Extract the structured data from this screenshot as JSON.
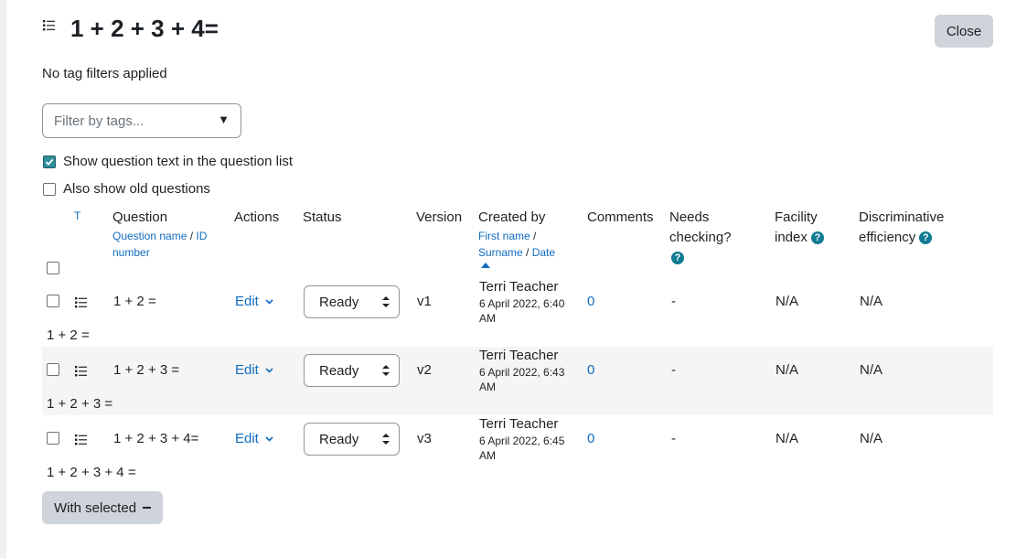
{
  "header": {
    "title": "1 + 2 + 3 + 4=",
    "close_label": "Close"
  },
  "tags": {
    "status": "No tag filters applied",
    "filter_placeholder": "Filter by tags...",
    "filter_arrow": "▼"
  },
  "options": {
    "show_question_text": {
      "label": "Show question text in the question list",
      "checked": true
    },
    "show_old_questions": {
      "label": "Also show old questions",
      "checked": false
    }
  },
  "table": {
    "headers": {
      "type": "T",
      "question": "Question",
      "question_sub_name": "Question name",
      "question_sub_sep": " / ",
      "question_sub_id": "ID number",
      "actions": "Actions",
      "status": "Status",
      "version": "Version",
      "created_by": "Created by",
      "created_first": "First name",
      "created_sep1": " / ",
      "created_surname": "Surname",
      "created_sep2": " / ",
      "created_date": "Date",
      "comments": "Comments",
      "needs_checking": "Needs checking?",
      "facility_index": "Facility index",
      "discriminative": "Discriminative efficiency"
    },
    "rows": [
      {
        "name": "1 + 2 =",
        "action": "Edit",
        "status": "Ready",
        "version": "v1",
        "creator": "Terri Teacher",
        "date": "6 April 2022, 6:40 AM",
        "comments": "0",
        "needs_checking": "-",
        "facility": "N/A",
        "discriminative": "N/A",
        "text": "1 + 2 ="
      },
      {
        "name": "1 + 2 + 3 =",
        "action": "Edit",
        "status": "Ready",
        "version": "v2",
        "creator": "Terri Teacher",
        "date": "6 April 2022, 6:43 AM",
        "comments": "0",
        "needs_checking": "-",
        "facility": "N/A",
        "discriminative": "N/A",
        "text": "1 + 2 + 3 ="
      },
      {
        "name": "1 + 2 + 3 + 4=",
        "action": "Edit",
        "status": "Ready",
        "version": "v3",
        "creator": "Terri Teacher",
        "date": "6 April 2022, 6:45 AM",
        "comments": "0",
        "needs_checking": "-",
        "facility": "N/A",
        "discriminative": "N/A",
        "text": "1 + 2 + 3 + 4 ="
      }
    ]
  },
  "footer": {
    "with_selected": "With selected"
  },
  "colors": {
    "link": "#0f6cbf",
    "button_bg": "#ced4da",
    "help_icon": "#0f7a91",
    "alt_row": "#f5f5f5"
  }
}
